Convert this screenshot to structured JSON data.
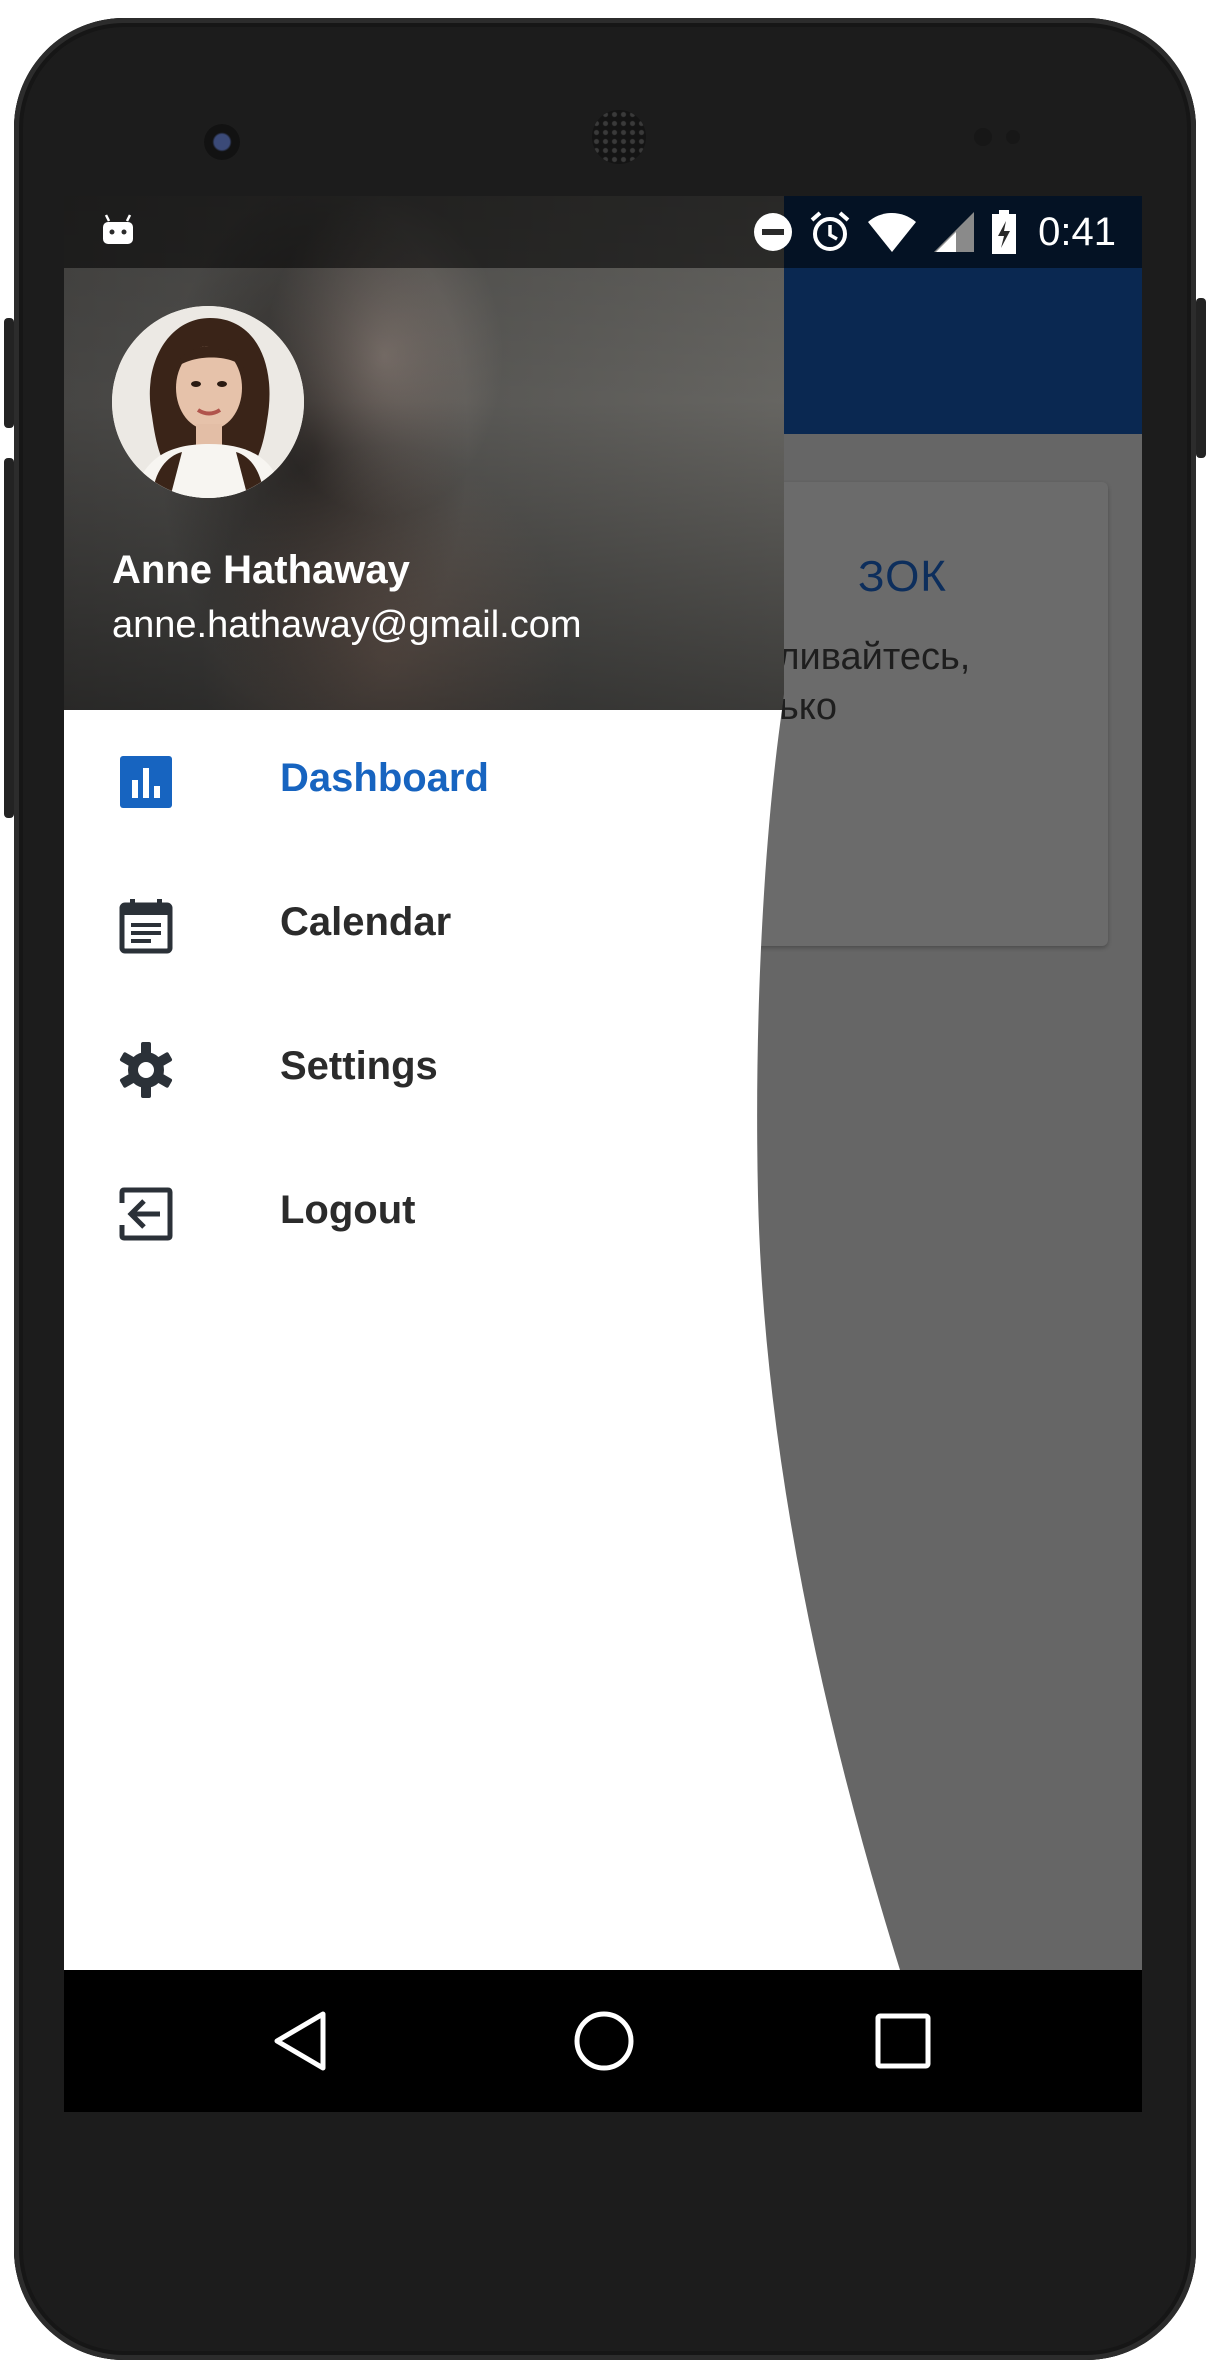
{
  "status_bar": {
    "time": "0:41",
    "icons": [
      "android-debug-icon",
      "do-not-disturb-icon",
      "alarm-icon",
      "wifi-icon",
      "cell-signal-icon",
      "battery-charging-icon"
    ]
  },
  "drawer": {
    "header": {
      "user_name": "Anne Hathaway",
      "user_email": "anne.hathaway@gmail.com"
    },
    "menu": [
      {
        "label": "Dashboard",
        "icon": "bar-chart-icon",
        "active": true
      },
      {
        "label": "Calendar",
        "icon": "calendar-icon",
        "active": false
      },
      {
        "label": "Settings",
        "icon": "gear-icon",
        "active": false
      },
      {
        "label": "Logout",
        "icon": "logout-icon",
        "active": false
      }
    ]
  },
  "background_app": {
    "card_title": "ЗОК",
    "card_text_line1": "вливайтесь,",
    "card_text_line2": "нько"
  },
  "navigation_bar": {
    "buttons": [
      "back-icon",
      "home-icon",
      "recents-icon"
    ]
  },
  "colors": {
    "app_bar": "#0a2851",
    "active_item": "#1764c0",
    "menu_text": "#2b2b2b",
    "scrim": "#666666"
  }
}
